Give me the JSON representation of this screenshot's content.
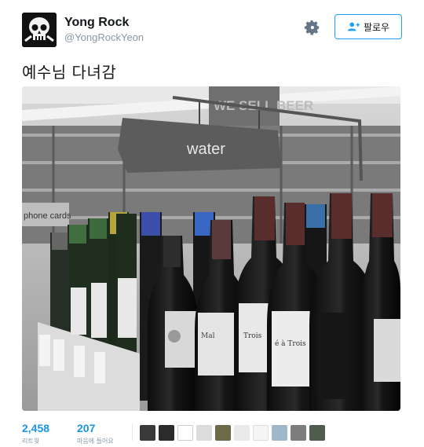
{
  "user": {
    "name": "Yong Rock",
    "handle": "@YongRockYeon"
  },
  "follow_button": {
    "label": "팔로우"
  },
  "tweet": {
    "text": "예수님 다녀감",
    "photo": {
      "sign_text": "water",
      "background_sign": "WE SELL BEER",
      "side_sign": "phone cards"
    }
  },
  "stats": {
    "retweets": {
      "count": "2,458",
      "label": "리트윗"
    },
    "likes": {
      "count": "207",
      "label": "마음에 들어요"
    }
  },
  "likers": [
    {
      "icon": "liker-avatar"
    },
    {
      "icon": "liker-avatar"
    },
    {
      "icon": "liker-avatar"
    },
    {
      "icon": "liker-avatar"
    },
    {
      "icon": "liker-avatar"
    },
    {
      "icon": "liker-avatar"
    },
    {
      "icon": "liker-avatar"
    },
    {
      "icon": "liker-avatar"
    },
    {
      "icon": "liker-avatar"
    },
    {
      "icon": "liker-avatar"
    }
  ],
  "colors": {
    "accent": "#1da1f2",
    "count": "#1b95e0",
    "muted": "#8899a6"
  }
}
